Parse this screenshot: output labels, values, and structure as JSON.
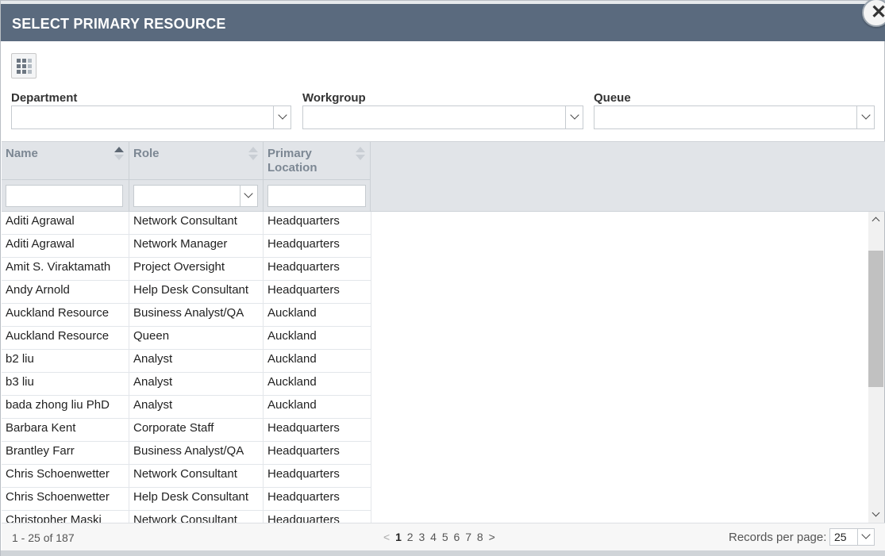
{
  "dialog": {
    "title": "SELECT PRIMARY RESOURCE"
  },
  "toolbar": {
    "grid_icon": "grid-view-icon",
    "close_icon": "close-icon",
    "close_glyph": "✕"
  },
  "filters": [
    {
      "label": "Department",
      "value": ""
    },
    {
      "label": "Workgroup",
      "value": ""
    },
    {
      "label": "Queue",
      "value": ""
    }
  ],
  "grid": {
    "columns": [
      "Name",
      "Role",
      "Primary Location"
    ],
    "column_filters": {
      "name": "",
      "role": "",
      "location": ""
    },
    "rows": [
      [
        "Aditi Agrawal",
        "Network Consultant",
        "Headquarters"
      ],
      [
        "Aditi Agrawal",
        "Network Manager",
        "Headquarters"
      ],
      [
        "Amit S. Viraktamath",
        "Project Oversight",
        "Headquarters"
      ],
      [
        "Andy Arnold",
        "Help Desk Consultant",
        "Headquarters"
      ],
      [
        "Auckland Resource",
        "Business Analyst/QA",
        "Auckland"
      ],
      [
        "Auckland Resource",
        "Queen",
        "Auckland"
      ],
      [
        "b2 liu",
        "Analyst",
        "Auckland"
      ],
      [
        "b3 liu",
        "Analyst",
        "Auckland"
      ],
      [
        "bada zhong liu PhD",
        "Analyst",
        "Auckland"
      ],
      [
        "Barbara Kent",
        "Corporate Staff",
        "Headquarters"
      ],
      [
        "Brantley Farr",
        "Business Analyst/QA",
        "Headquarters"
      ],
      [
        "Chris Schoenwetter",
        "Network Consultant",
        "Headquarters"
      ],
      [
        "Chris Schoenwetter",
        "Help Desk Consultant",
        "Headquarters"
      ],
      [
        "Christopher Maski",
        "Network Consultant",
        "Headquarters"
      ]
    ]
  },
  "footer": {
    "range": "1 - 25 of 187",
    "prev": "<",
    "pages": [
      "1",
      "2",
      "3",
      "4",
      "5",
      "6",
      "7",
      "8"
    ],
    "current_page": "1",
    "next": ">",
    "records_label": "Records per page:",
    "records_value": "25"
  },
  "colors": {
    "titlebar": "#5a6a7e",
    "header_bg": "#e1e4e8"
  }
}
